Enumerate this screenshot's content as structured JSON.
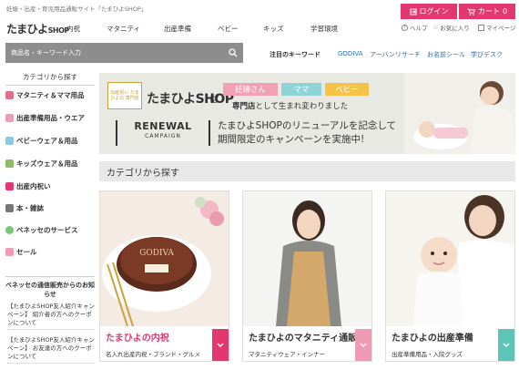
{
  "header": {
    "top_note": "妊娠・出産・育児用品通販サイト「たまひよSHOP」",
    "logo": "たまひよ",
    "logo_suffix": "SHOP",
    "nav": [
      "内祝",
      "マタニティ",
      "出産準備",
      "ベビー",
      "キッズ",
      "学習環境"
    ],
    "login_label": "ログイン",
    "cart_label": "カート",
    "cart_count": "0",
    "help_label": "ヘルプ",
    "favorites_label": "お気に入り",
    "mypage_label": "マイページ"
  },
  "search": {
    "placeholder": "商品名・キーワード入力",
    "keywords_label": "注目のキーワード",
    "keywords": [
      "GODIVA",
      "アーバンリサーチ",
      "お名前シール",
      "学びデスク"
    ]
  },
  "sidebar": {
    "heading": "カテゴリから探す",
    "items": [
      {
        "label": "マタニティ＆ママ用品",
        "color": "#e0708f"
      },
      {
        "label": "出産準備用品・ウエア",
        "color": "#e89fb3"
      },
      {
        "label": "ベビーウェア＆用品",
        "color": "#8ec7e0"
      },
      {
        "label": "キッズウェア＆用品",
        "color": "#8dbb63"
      },
      {
        "label": "出産内祝い",
        "color": "#e2386f"
      },
      {
        "label": "本・雑誌",
        "color": "#777777"
      },
      {
        "label": "ベネッセのサービス",
        "color": "#7cc576"
      },
      {
        "label": "セール",
        "color": "#f09ab5"
      }
    ],
    "notice_heading": "ベネッセの通信販売からのお知らせ",
    "notices": [
      "【たまひよSHOP友人紹介キャンペーン】 紹介者の方へのクーポンについて",
      "【たまひよSHOP友人紹介キャンペーン】 お友達の方へのクーポンについて"
    ]
  },
  "banner": {
    "badge": "出産祝い たまひよの 専門店",
    "name": "たまひよSHOP",
    "wa": "は",
    "tags": [
      {
        "label": "妊婦さん",
        "color": "#f2a0b5"
      },
      {
        "label": "ママ",
        "color": "#8fd3d8"
      },
      {
        "label": "ベビー",
        "color": "#f3c246"
      }
    ],
    "sub_bold": "専門店",
    "sub_rest": "として生まれ変わりました",
    "renewal_title": "RENEWAL",
    "renewal_sub": "CAMPAIGN",
    "message_line1": "たまひよSHOPのリニューアルを記念して",
    "message_line2": "期間限定のキャンペーンを実施中!"
  },
  "section": {
    "title": "カテゴリから探す"
  },
  "cards": [
    {
      "title_brand": "たまひよ",
      "title_rest": "の内祝",
      "subtitle": "名入れ出産内祝・ブランド・グルメ",
      "accent": "#e2386f",
      "photo_text": "GODIVA"
    },
    {
      "title_brand": "たまひよ",
      "title_rest": "のマタニティ通販",
      "subtitle": "マタニティウェア・インナー",
      "accent": "#f09ab5",
      "photo_text": ""
    },
    {
      "title_brand": "たまひよ",
      "title_rest": "の出産準備",
      "subtitle": "出産準備用品・入院グッズ",
      "accent": "#5fc4b8",
      "photo_text": ""
    }
  ]
}
